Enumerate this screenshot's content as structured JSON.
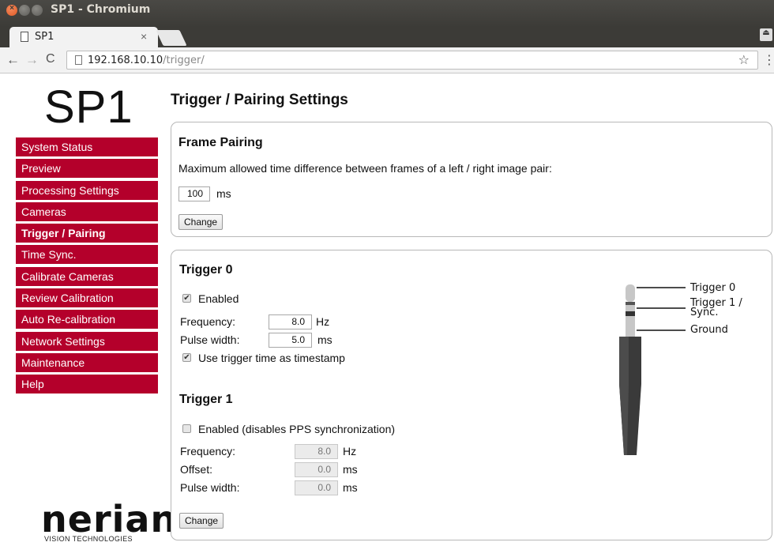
{
  "browser": {
    "window_title": "SP1 - Chromium",
    "tab_title": "SP1",
    "url_host": "192.168.10.10",
    "url_path": "/trigger/"
  },
  "sidebar": {
    "logo": "SP1",
    "items": [
      {
        "label": "System Status",
        "active": false
      },
      {
        "label": "Preview",
        "active": false
      },
      {
        "label": "Processing Settings",
        "active": false
      },
      {
        "label": "Cameras",
        "active": false
      },
      {
        "label": "Trigger / Pairing",
        "active": true
      },
      {
        "label": "Time Sync.",
        "active": false
      },
      {
        "label": "Calibrate Cameras",
        "active": false
      },
      {
        "label": "Review Calibration",
        "active": false
      },
      {
        "label": "Auto Re-calibration",
        "active": false
      },
      {
        "label": "Network Settings",
        "active": false
      },
      {
        "label": "Maintenance",
        "active": false
      },
      {
        "label": "Help",
        "active": false
      }
    ],
    "brand_name": "nerian",
    "brand_sub": "VISION TECHNOLOGIES",
    "accent_color": "#b4002b"
  },
  "main": {
    "title": "Trigger / Pairing Settings",
    "frame_pairing": {
      "heading": "Frame Pairing",
      "description": "Maximum allowed time difference between frames of a left / right image pair:",
      "value": "100",
      "unit": "ms",
      "button": "Change"
    },
    "trigger0": {
      "heading": "Trigger 0",
      "enabled_label": "Enabled",
      "enabled": true,
      "frequency_label": "Frequency:",
      "frequency": "8.0",
      "frequency_unit": "Hz",
      "pulse_label": "Pulse width:",
      "pulse": "5.0",
      "pulse_unit": "ms",
      "timestamp_label": "Use trigger time as timestamp",
      "timestamp": true
    },
    "trigger1": {
      "heading": "Trigger 1",
      "enabled_label": "Enabled (disables PPS synchronization)",
      "enabled": false,
      "frequency_label": "Frequency:",
      "frequency": "8.0",
      "frequency_unit": "Hz",
      "offset_label": "Offset:",
      "offset": "0.0",
      "offset_unit": "ms",
      "pulse_label": "Pulse width:",
      "pulse": "0.0",
      "pulse_unit": "ms",
      "button": "Change"
    },
    "connector": {
      "trigger0": "Trigger 0",
      "trigger1_line1": "Trigger 1 /",
      "trigger1_line2": "Sync.",
      "ground": "Ground"
    }
  }
}
